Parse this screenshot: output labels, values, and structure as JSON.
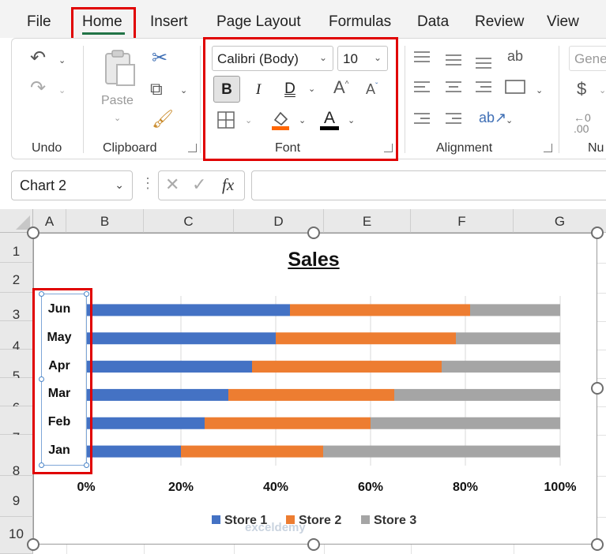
{
  "menu": {
    "tabs": [
      "File",
      "Home",
      "Insert",
      "Page Layout",
      "Formulas",
      "Data",
      "Review",
      "View"
    ],
    "active": "Home"
  },
  "ribbon": {
    "groups": [
      "Undo",
      "Clipboard",
      "Font",
      "Alignment",
      "Nu"
    ],
    "paste_label": "Paste",
    "font_name": "Calibri (Body)",
    "font_size": "10",
    "number_format": "Gene",
    "bold_glyph": "B",
    "italic_glyph": "I",
    "double_underline_glyph": "D",
    "font_color_glyph": "A",
    "font_color": "#000000",
    "fill_color": "#ff6600"
  },
  "formula_bar": {
    "name_box": "Chart 2",
    "fx_label": "fx",
    "value": ""
  },
  "sheet": {
    "columns": [
      "A",
      "B",
      "C",
      "D",
      "E",
      "F",
      "G"
    ],
    "rows": [
      "1",
      "2",
      "3",
      "4",
      "5",
      "6",
      "7",
      "8",
      "9",
      "10"
    ]
  },
  "chart_data": {
    "type": "bar",
    "stacked": "100%",
    "orientation": "horizontal",
    "title": "Sales",
    "categories": [
      "Jan",
      "Feb",
      "Mar",
      "Apr",
      "May",
      "Jun"
    ],
    "series": [
      {
        "name": "Store 1",
        "color": "#4472C4",
        "values": [
          20,
          25,
          30,
          35,
          40,
          43
        ]
      },
      {
        "name": "Store 2",
        "color": "#ED7D31",
        "values": [
          30,
          35,
          35,
          40,
          38,
          38
        ]
      },
      {
        "name": "Store 3",
        "color": "#A5A5A5",
        "values": [
          50,
          40,
          35,
          25,
          22,
          19
        ]
      }
    ],
    "x_ticks": [
      "0%",
      "20%",
      "40%",
      "60%",
      "80%",
      "100%"
    ],
    "xlim": [
      0,
      100
    ],
    "grid": true,
    "legend_position": "bottom"
  },
  "watermark": "exceldemy"
}
